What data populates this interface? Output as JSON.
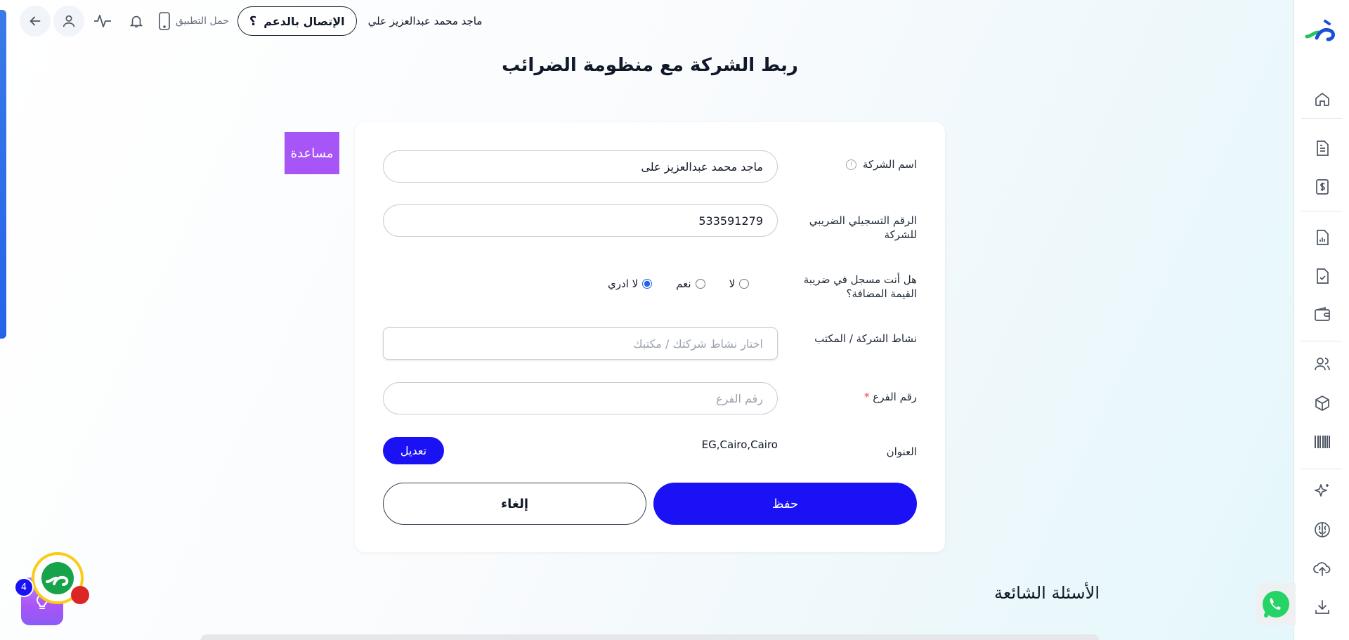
{
  "topbar": {
    "download_app_label": "حمل التطبيق",
    "support_label": "الإتصال بالدعم",
    "support_icon_glyph": "؟",
    "user_name": "ماجد محمد عبدالعزيز علي"
  },
  "page": {
    "title": "ربط الشركة مع منظومة الضرائب"
  },
  "help_tab": {
    "label": "مساعدة"
  },
  "form": {
    "company_name_label": "اسم الشركة",
    "company_name_info_glyph": "i",
    "company_name_value": "ماجد محمد عبدالعزيز على",
    "tax_reg_label": "الرقم التسجيلي الضريبي للشركة",
    "tax_reg_value": "533591279",
    "vat_question_label": "هل أنت مسجل في ضريبة القيمة المضافة؟",
    "vat_options": {
      "dont_know": "لا ادري",
      "yes": "نعم",
      "no": "لا"
    },
    "vat_selected": "dont_know",
    "activity_label": "نشاط الشركة / المكتب",
    "activity_placeholder": "اختار نشاط شركتك / مكتبك",
    "branch_label": "رقم الفرع",
    "branch_required_mark": "*",
    "branch_placeholder": "رقم الفرع",
    "address_label": "العنوان",
    "address_value": "EG,Cairo,Cairo",
    "edit_label": "تعديل",
    "save_label": "حفظ",
    "cancel_label": "إلغاء"
  },
  "faq": {
    "title": "الأسئلة الشائعة"
  },
  "assistant": {
    "badge_count": "4"
  },
  "colors": {
    "primary": "#1a12f5",
    "help_tab": "#a855f7",
    "accent_bar": "#2563eb",
    "brand_green": "#22c55e",
    "brand_blue": "#1d4ed8"
  },
  "sidebar_icons": [
    "home-icon",
    "document-icon",
    "dollar-document-icon",
    "chart-file-icon",
    "check-file-icon",
    "wallet-icon",
    "users-icon",
    "box-icon",
    "barcode-icon",
    "sparkle-icon",
    "brain-icon",
    "upload-icon",
    "download-icon"
  ]
}
